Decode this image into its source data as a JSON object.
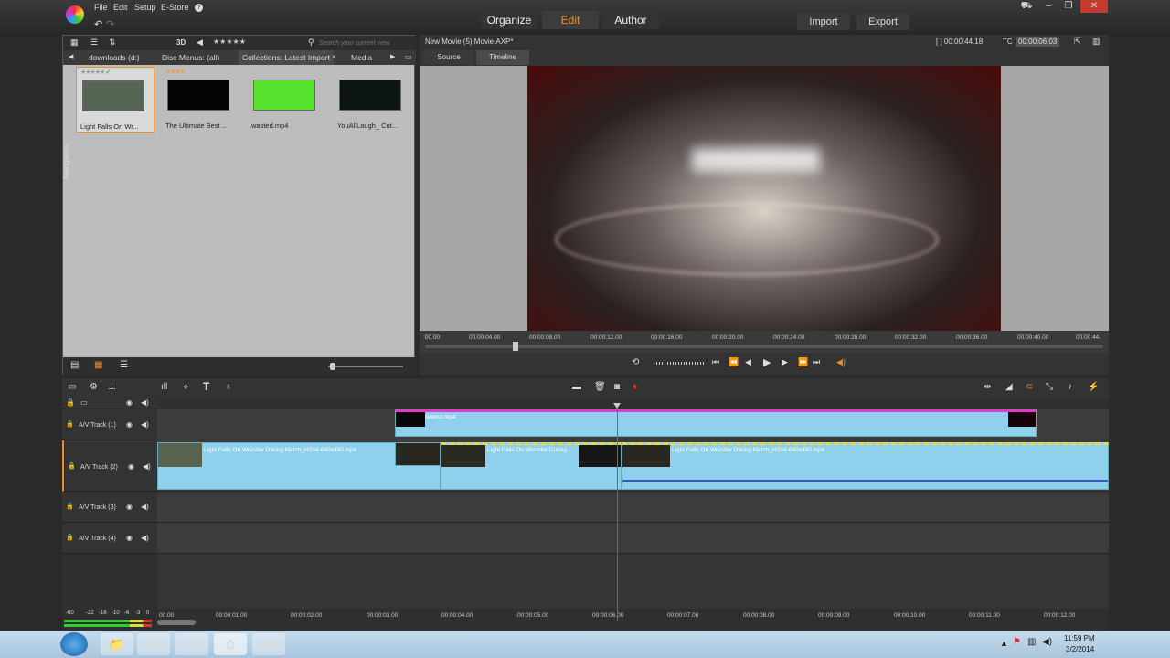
{
  "menu": [
    "File",
    "Edit",
    "Setup",
    "E-Store"
  ],
  "modes": [
    {
      "label": "Organize",
      "active": false
    },
    {
      "label": "Edit",
      "active": true
    },
    {
      "label": "Author",
      "active": false
    }
  ],
  "actions": {
    "import": "Import",
    "export": "Export"
  },
  "library": {
    "view3d": "3D",
    "search_placeholder": "Search your current view",
    "tabs": [
      "downloads (d:)",
      "Disc Menus: (all)",
      "Collections: Latest Import",
      "Media"
    ],
    "clips": [
      {
        "name": "Light Falls On Wr...",
        "color": "#556655"
      },
      {
        "name": "The Ultimate Best ...",
        "color": "#050505"
      },
      {
        "name": "wasted.mp4",
        "color": "#57e22e"
      },
      {
        "name": "YouAllLaugh_ Cut...",
        "color": "#0c1410"
      }
    ],
    "nav_label": "Navigation"
  },
  "preview": {
    "title": "New Movie (5).Movie.AXP*",
    "duration": "[ ] 00:00:44.18",
    "tc_label": "TC",
    "timecode": "00:00:06.03",
    "tabs": [
      "Source",
      "Timeline"
    ],
    "ruler": [
      ":00.00",
      "00:00:04.00",
      "00:00:08.00",
      "00:00:12.00",
      "00:00:16.00",
      "00:00:20.00",
      "00:00:24.00",
      "00:00:28.00",
      "00:00:32.00",
      "00:00:36.00",
      "00:00:40.00",
      "00:00:44."
    ]
  },
  "timeline": {
    "tracks": [
      "A/V Track (1)",
      "A/V Track (2)",
      "A/V Track (3)",
      "A/V Track (4)"
    ],
    "track1_clip": "rewind.mp4",
    "track2_clips": [
      "Light Falls On Wrestler During Match_H264-640x480.mp4",
      "Light Falls On Wrestler During...",
      "Light Falls On Wrestler During Match_H264-640x480.mp4"
    ],
    "meter": [
      "-60",
      "-22",
      "-16",
      "-10",
      "-6",
      "-3",
      "0"
    ],
    "ruler": [
      "00.00",
      "00:00:01.00",
      "00:00:02.00",
      "00:00:03.00",
      "00:00:04.00",
      "00:00:05.00",
      "00:00:06.00",
      "00:00:07.00",
      "00:00:08.00",
      "00:00:09.00",
      "00:00:10.00",
      "00:00:11.00",
      "00:00:12.00"
    ]
  },
  "taskbar": {
    "time": "11:59 PM",
    "date": "3/2/2014"
  }
}
